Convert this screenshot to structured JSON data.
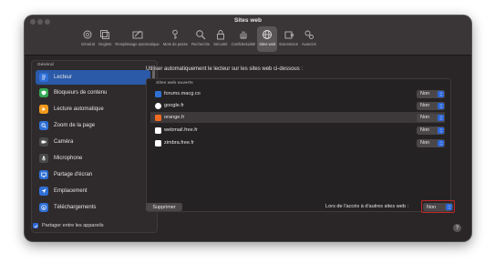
{
  "window": {
    "title": "Sites web"
  },
  "toolbar": {
    "items": [
      {
        "label": "Général",
        "icon": "gear-icon"
      },
      {
        "label": "Onglets",
        "icon": "tabs-icon"
      },
      {
        "label": "Remplissage automatique",
        "icon": "pencil-icon"
      },
      {
        "label": "Mots de passe",
        "icon": "key-icon"
      },
      {
        "label": "Recherche",
        "icon": "search-icon"
      },
      {
        "label": "Sécurité",
        "icon": "lock-icon"
      },
      {
        "label": "Confidentialité",
        "icon": "hand-icon"
      },
      {
        "label": "Sites web",
        "icon": "globe-icon",
        "active": true
      },
      {
        "label": "Extensions",
        "icon": "puzzle-icon"
      },
      {
        "label": "Avancés",
        "icon": "advanced-gears-icon"
      }
    ]
  },
  "sidebar": {
    "section": "Général",
    "items": [
      {
        "label": "Lecteur",
        "icon": "reader-icon",
        "color": "#2f6fd6",
        "selected": true
      },
      {
        "label": "Bloqueurs de contenu",
        "icon": "blocker-icon",
        "color": "#34a853"
      },
      {
        "label": "Lecture automatique",
        "icon": "play-icon",
        "color": "#f29b1e"
      },
      {
        "label": "Zoom de la page",
        "icon": "zoom-icon",
        "color": "#2f6fd6"
      },
      {
        "label": "Caméra",
        "icon": "camera-icon",
        "color": "#4a4a4a"
      },
      {
        "label": "Microphone",
        "icon": "microphone-icon",
        "color": "#4a4a4a"
      },
      {
        "label": "Partage d'écran",
        "icon": "screen-share-icon",
        "color": "#2f6fd6"
      },
      {
        "label": "Emplacement",
        "icon": "location-icon",
        "color": "#2f6fd6"
      },
      {
        "label": "Téléchargements",
        "icon": "download-icon",
        "color": "#2f6fd6"
      }
    ]
  },
  "share": {
    "label": "Partager entre les appareils",
    "checked": true
  },
  "main": {
    "description": "Utiliser automatiquement le lecteur sur les sites web ci-dessous :",
    "list_header": "Sites web ouverts",
    "sites": [
      {
        "name": "forums.macg.co",
        "value": "Non",
        "icon_color": "#2f6fd6"
      },
      {
        "name": "google.fr",
        "value": "Non",
        "icon_color": "#ffffff"
      },
      {
        "name": "orange.fr",
        "value": "Non",
        "icon_color": "#f26a21",
        "highlighted": true
      },
      {
        "name": "webmail.free.fr",
        "value": "Non",
        "icon_color": "#ffffff"
      },
      {
        "name": "zimbra.free.fr",
        "value": "Non",
        "icon_color": "#ffffff"
      }
    ],
    "remove_label": "Supprimer",
    "other_sites_label": "Lors de l'accès à d'autres sites web :",
    "other_sites_value": "Non"
  },
  "help": {
    "label": "?"
  },
  "colors": {
    "accent": "#2c66d8",
    "highlight_border": "#c0282a"
  }
}
